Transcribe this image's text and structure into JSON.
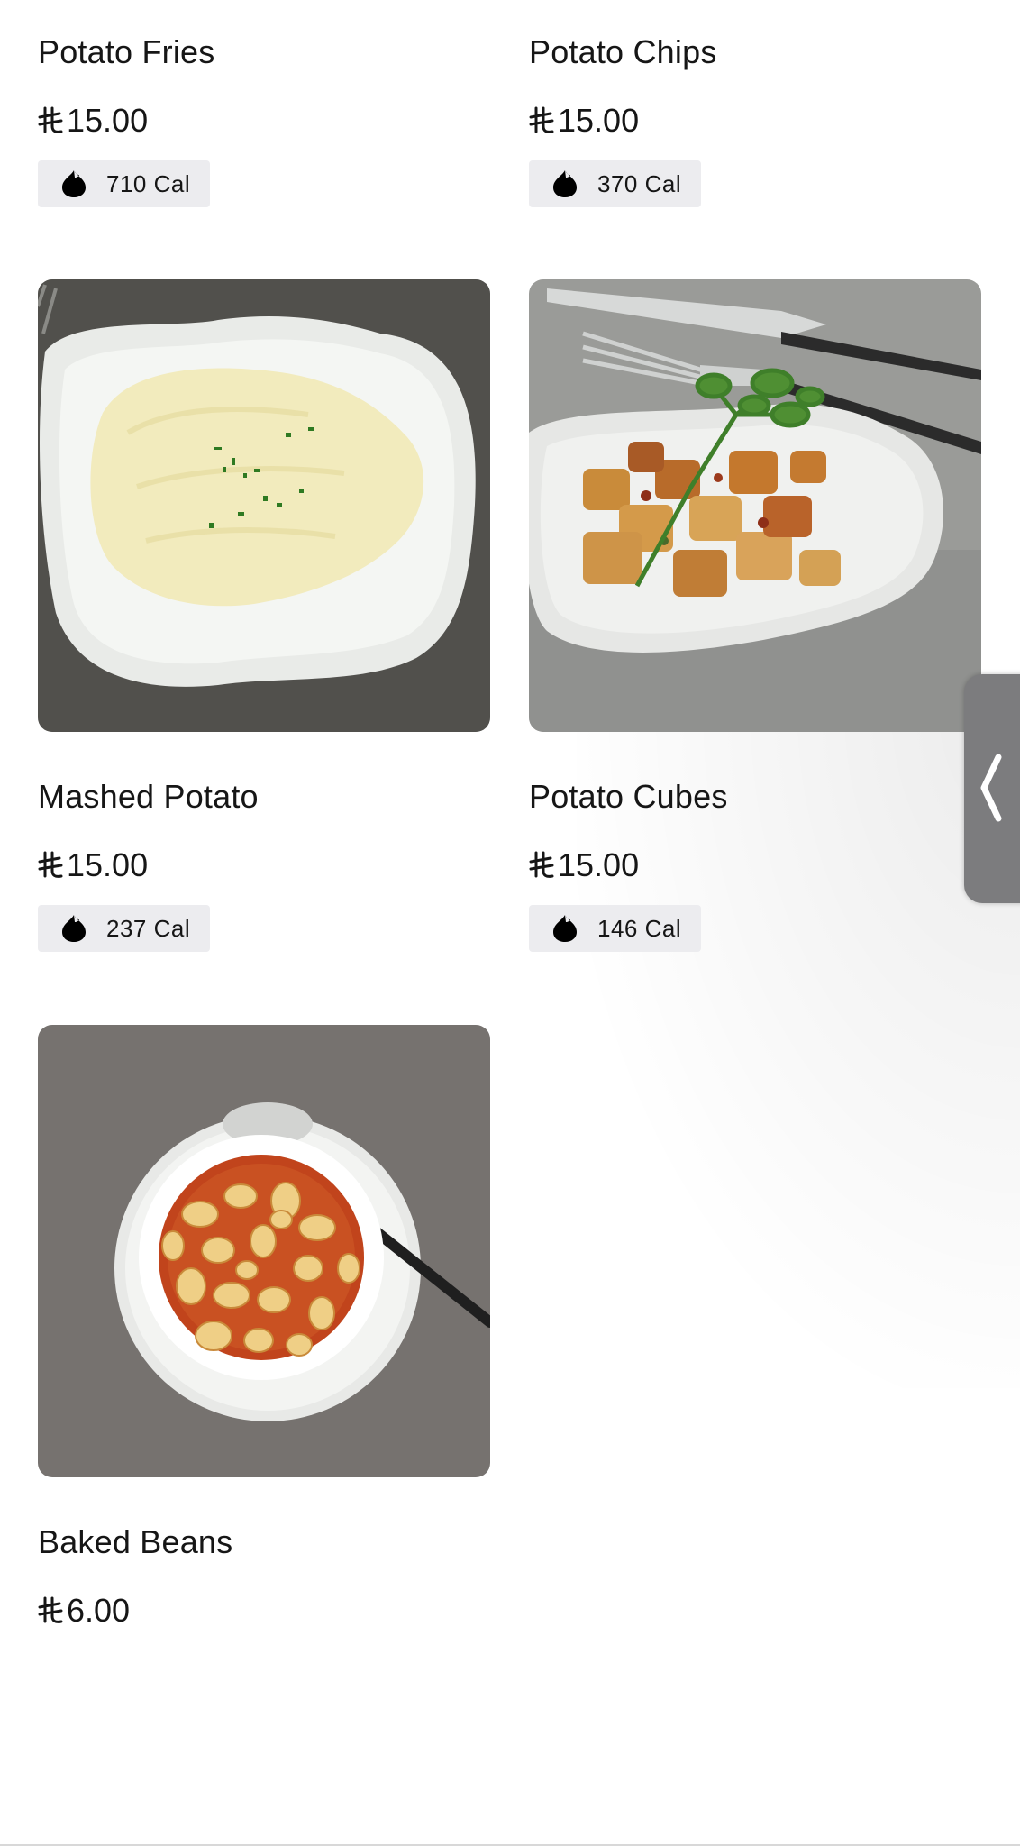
{
  "currency_icon": "riyal-currency-icon",
  "calorie_icon": "flame-drop-icon",
  "items": [
    {
      "name": "Potato Fries",
      "price": "15.00",
      "calories": "710 Cal"
    },
    {
      "name": "Potato Chips",
      "price": "15.00",
      "calories": "370 Cal"
    },
    {
      "name": "Mashed Potato",
      "price": "15.00",
      "calories": "237 Cal"
    },
    {
      "name": "Potato Cubes",
      "price": "15.00",
      "calories": "146 Cal"
    },
    {
      "name": "Baked Beans",
      "price": "6.00"
    }
  ],
  "side_tab": {
    "icon": "chevron-left-icon"
  },
  "colors": {
    "chip_bg": "#ececef",
    "tab_bg": "#7c7c7e",
    "text": "#161616"
  }
}
